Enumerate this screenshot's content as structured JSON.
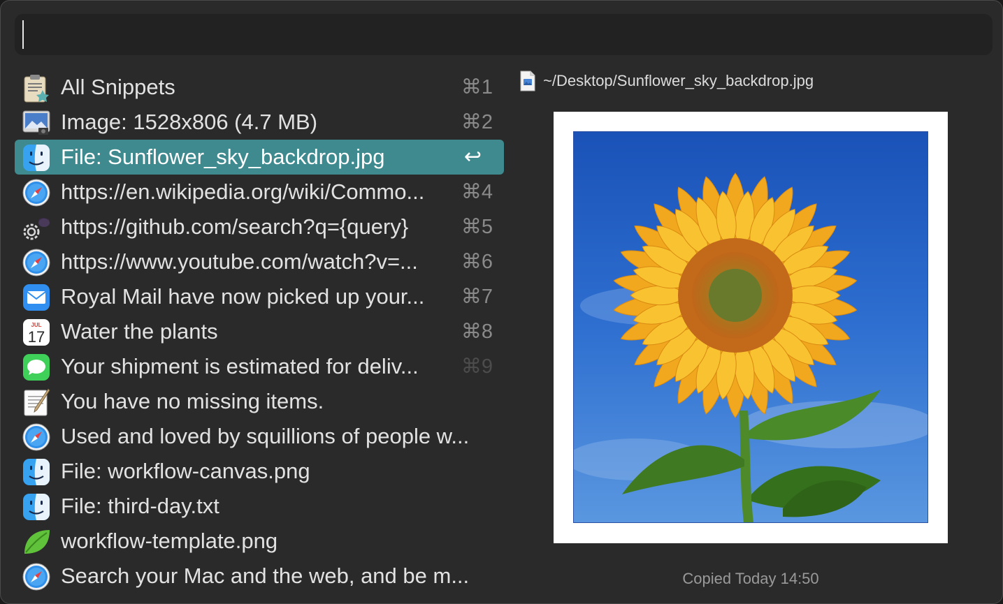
{
  "search": {
    "value": "",
    "placeholder": ""
  },
  "results": [
    {
      "icon": "snippets-clipboard-icon",
      "label": "All Snippets",
      "shortcut": "⌘1"
    },
    {
      "icon": "preview-image-icon",
      "label": "Image: 1528x806 (4.7 MB)",
      "shortcut": "⌘2"
    },
    {
      "icon": "finder-icon",
      "label": "File: Sunflower_sky_backdrop.jpg",
      "shortcut": "↩",
      "selected": true
    },
    {
      "icon": "safari-icon",
      "label": "https://en.wikipedia.org/wiki/Commo...",
      "shortcut": "⌘4"
    },
    {
      "icon": "workflow-gear-icon",
      "label": "https://github.com/search?q={query}",
      "shortcut": "⌘5"
    },
    {
      "icon": "safari-icon",
      "label": "https://www.youtube.com/watch?v=...",
      "shortcut": "⌘6"
    },
    {
      "icon": "mail-icon",
      "label": "Royal Mail have now picked up your...",
      "shortcut": "⌘7"
    },
    {
      "icon": "calendar-icon",
      "label": "Water the plants",
      "shortcut": "⌘8",
      "calendar_month": "JUL",
      "calendar_day": "17"
    },
    {
      "icon": "messages-icon",
      "label": "Your shipment is estimated for deliv...",
      "shortcut": "⌘9",
      "faint": true
    },
    {
      "icon": "textedit-icon",
      "label": "You have no missing items.",
      "shortcut": ""
    },
    {
      "icon": "safari-icon",
      "label": "Used and loved by squillions of people w...",
      "shortcut": ""
    },
    {
      "icon": "finder-icon",
      "label": "File: workflow-canvas.png",
      "shortcut": ""
    },
    {
      "icon": "finder-icon",
      "label": "File: third-day.txt",
      "shortcut": ""
    },
    {
      "icon": "leaf-icon",
      "label": "workflow-template.png",
      "shortcut": ""
    },
    {
      "icon": "safari-icon",
      "label": "Search your Mac and the web, and be m...",
      "shortcut": ""
    }
  ],
  "preview": {
    "path": "~/Desktop/Sunflower_sky_backdrop.jpg",
    "image": "sunflower-photo",
    "copied": "Copied Today 14:50"
  },
  "colors": {
    "selection": "#3e8a8e",
    "window": "#2a2a2a",
    "search_bg": "#222222"
  }
}
